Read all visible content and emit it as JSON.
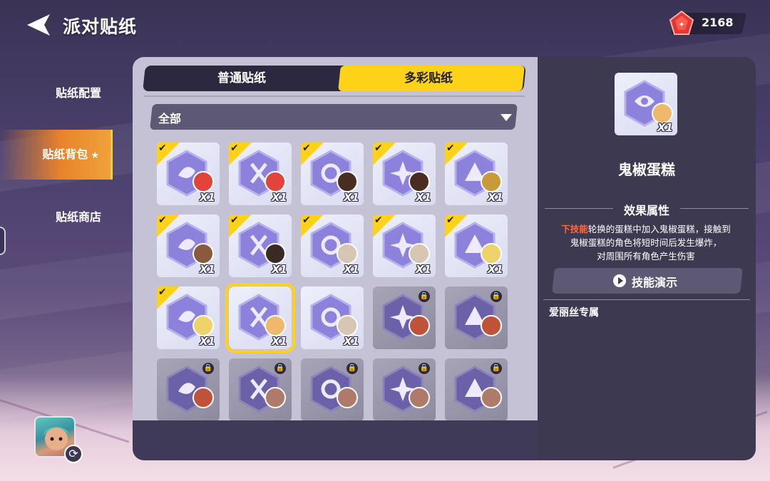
{
  "header": {
    "title": "派对贴纸",
    "currency_value": "2168",
    "currency_icon": "red-gem-icon"
  },
  "nav": {
    "items": [
      {
        "label": "贴纸配置",
        "active": false
      },
      {
        "label": "贴纸背包",
        "active": true
      },
      {
        "label": "贴纸商店",
        "active": false
      }
    ]
  },
  "tabs": {
    "normal": "普通贴纸",
    "colorful": "多彩贴纸",
    "active": "colorful"
  },
  "filter": {
    "selected": "全部"
  },
  "stickers": [
    {
      "owned": true,
      "locked": false,
      "count": "X1",
      "selected": false,
      "char_color": "#e2443a"
    },
    {
      "owned": true,
      "locked": false,
      "count": "X1",
      "selected": false,
      "char_color": "#e2443a"
    },
    {
      "owned": true,
      "locked": false,
      "count": "X1",
      "selected": false,
      "char_color": "#4a2d22"
    },
    {
      "owned": true,
      "locked": false,
      "count": "X1",
      "selected": false,
      "char_color": "#4a2d22"
    },
    {
      "owned": true,
      "locked": false,
      "count": "X1",
      "selected": false,
      "char_color": "#c99a3a"
    },
    {
      "owned": true,
      "locked": false,
      "count": "X1",
      "selected": false,
      "char_color": "#8a5a3c"
    },
    {
      "owned": true,
      "locked": false,
      "count": "X1",
      "selected": false,
      "char_color": "#3a2a24"
    },
    {
      "owned": true,
      "locked": false,
      "count": "X1",
      "selected": false,
      "char_color": "#d8c6b4"
    },
    {
      "owned": true,
      "locked": false,
      "count": "X1",
      "selected": false,
      "char_color": "#d8c6b4"
    },
    {
      "owned": true,
      "locked": false,
      "count": "X1",
      "selected": false,
      "char_color": "#f0d26a"
    },
    {
      "owned": true,
      "locked": false,
      "count": "X1",
      "selected": false,
      "char_color": "#f0d26a"
    },
    {
      "owned": false,
      "locked": false,
      "count": "X1",
      "selected": true,
      "char_color": "#f0b86a"
    },
    {
      "owned": false,
      "locked": false,
      "count": "X1",
      "selected": false,
      "char_color": "#d8c6b4"
    },
    {
      "owned": false,
      "locked": true,
      "count": "",
      "selected": false,
      "char_color": "#c0523a"
    },
    {
      "owned": false,
      "locked": true,
      "count": "",
      "selected": false,
      "char_color": "#c0523a"
    },
    {
      "owned": false,
      "locked": true,
      "count": "",
      "selected": false,
      "char_color": "#c0523a"
    },
    {
      "owned": false,
      "locked": true,
      "count": "",
      "selected": false,
      "char_color": "#b07a6a"
    },
    {
      "owned": false,
      "locked": true,
      "count": "",
      "selected": false,
      "char_color": "#b07a6a"
    },
    {
      "owned": false,
      "locked": true,
      "count": "",
      "selected": false,
      "char_color": "#b07a6a"
    },
    {
      "owned": false,
      "locked": true,
      "count": "",
      "selected": false,
      "char_color": "#b07a6a"
    }
  ],
  "detail": {
    "count": "X1",
    "name": "鬼椒蛋糕",
    "section_title": "效果属性",
    "desc_highlight": "下技能",
    "desc_line1": "轮换的蛋糕中加入鬼椒蛋糕，接触到",
    "desc_line2": "鬼椒蛋糕的角色将短时间后发生爆炸，",
    "desc_line3": "对周围所有角色产生伤害",
    "demo_label": "技能演示",
    "exclusive": "爱丽丝专属"
  },
  "colors": {
    "accent_yellow": "#ffd21a",
    "nav_active": "#e8832a",
    "highlight_red": "#ff6a3d"
  }
}
